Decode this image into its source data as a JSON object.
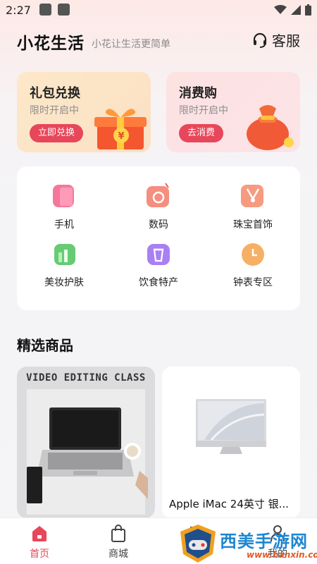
{
  "status": {
    "time": "2:27"
  },
  "header": {
    "title": "小花生活",
    "slogan": "小花让生活更简单",
    "service_label": "客服"
  },
  "promos": [
    {
      "title": "礼包兑换",
      "subtitle": "限时开启中",
      "button": "立即兑换"
    },
    {
      "title": "消费购",
      "subtitle": "限时开启中",
      "button": "去消费"
    }
  ],
  "categories": [
    {
      "label": "手机",
      "icon": "phone-icon",
      "color": "#f2608a"
    },
    {
      "label": "数码",
      "icon": "camera-icon",
      "color": "#f47a6a"
    },
    {
      "label": "珠宝首饰",
      "icon": "necklace-icon",
      "color": "#f48a6a"
    },
    {
      "label": "美妆护肤",
      "icon": "cosmetics-icon",
      "color": "#4cc25c"
    },
    {
      "label": "饮食特产",
      "icon": "cup-icon",
      "color": "#9a6af0"
    },
    {
      "label": "钟表专区",
      "icon": "watch-icon",
      "color": "#f4a24a"
    }
  ],
  "section": {
    "title": "精选商品"
  },
  "products": [
    {
      "image_title": "VIDEO EDITING CLASS",
      "name": ""
    },
    {
      "image_title": "",
      "name": "Apple iMac 24英寸 银..."
    }
  ],
  "tabs": [
    {
      "label": "首页",
      "icon": "home-icon",
      "active": true
    },
    {
      "label": "商城",
      "icon": "shopping-bag-icon",
      "active": false
    },
    {
      "label": "",
      "icon": "cart-icon",
      "active": false
    },
    {
      "label": "我的",
      "icon": "user-icon",
      "active": false
    }
  ],
  "watermark": {
    "text": "西美手游网",
    "url": "www.hanxin.com"
  },
  "colors": {
    "accent": "#e8465a"
  }
}
